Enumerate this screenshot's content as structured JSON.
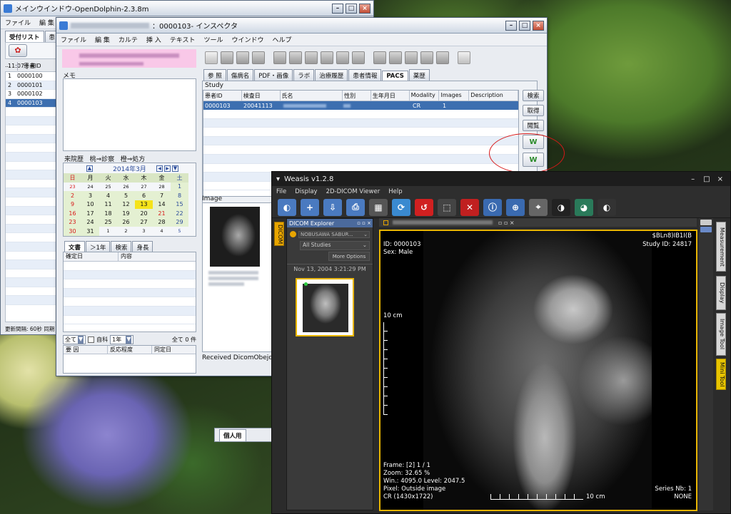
{
  "main_window": {
    "title": "メインウインドウ-OpenDolphin-2.3.8m",
    "menu": [
      "ファイル",
      "編 集",
      "カ"
    ],
    "tabs": [
      "受付リスト",
      "患"
    ],
    "time_text": "11:07 | 来",
    "col_header": "患者ID",
    "col_dots": "...",
    "rows": [
      {
        "n": "1",
        "id": "0000100"
      },
      {
        "n": "2",
        "id": "0000101"
      },
      {
        "n": "3",
        "id": "0000102"
      },
      {
        "n": "4",
        "id": "0000103"
      }
    ],
    "status": "更新間隔: 60秒 同期"
  },
  "inspector": {
    "title": "：0000103- インスペクタ",
    "menu": [
      "ファイル",
      "編 集",
      "カルテ",
      "挿 入",
      "テキスト",
      "ツール",
      "ウインドウ",
      "ヘルプ"
    ],
    "memo_label": "メモ",
    "visit_label": "来院歴",
    "legend1": "桃⇒診察",
    "legend2": "橙⇒処方",
    "cal_title": "2014年3月",
    "cal_days": [
      "日",
      "月",
      "火",
      "水",
      "木",
      "金",
      "土"
    ],
    "cal_weeks": [
      [
        "23",
        "24",
        "25",
        "26",
        "27",
        "28",
        "1"
      ],
      [
        "2",
        "3",
        "4",
        "5",
        "6",
        "7",
        "8"
      ],
      [
        "9",
        "10",
        "11",
        "12",
        "13",
        "14",
        "15"
      ],
      [
        "16",
        "17",
        "18",
        "19",
        "20",
        "21",
        "22"
      ],
      [
        "23",
        "24",
        "25",
        "26",
        "27",
        "28",
        "29"
      ],
      [
        "30",
        "31",
        "1",
        "2",
        "3",
        "4",
        "5"
      ]
    ],
    "doc_tabs": [
      "文書",
      "＞1年",
      "検索",
      "身長"
    ],
    "doc_cols": [
      "確定日",
      "内容"
    ],
    "filter_all": "全て",
    "filter_self": "自科",
    "filter_year": "1年",
    "count_text": "全て 0 件",
    "allergy_cols": [
      "要 因",
      "反応程度",
      "同定日"
    ],
    "bottom_tab": "個人用",
    "right_tabs": [
      "参 照",
      "傷病名",
      "PDF・画像",
      "ラボ",
      "治療履歴",
      "患者情報",
      "PACS",
      "薬歴"
    ],
    "study_label": "Study",
    "study_cols": [
      "患者ID",
      "検査日",
      "氏名",
      "性別",
      "生年月日",
      "Modality",
      "Images",
      "Description"
    ],
    "study_row": {
      "id": "0000103",
      "date": "20041113",
      "modality": "CR",
      "images": "1"
    },
    "buttons": [
      "検索",
      "取得",
      "閲覧"
    ],
    "image_label": "Image",
    "received_text": "Received DicomObejcet :"
  },
  "weasis": {
    "title": "Weasis v1.2.8",
    "menu": [
      "File",
      "Display",
      "2D-DICOM Viewer",
      "Help"
    ],
    "explorer_title": "DICOM Explorer",
    "side_tab": "DICOM",
    "patient_select": "NOBUSAWA SABUR...",
    "studies_select": "All Studies",
    "more_options": "More Options",
    "study_date": "Nov 13, 2004 3:21:29 PM",
    "ov": {
      "id": "ID: 0000103",
      "sex": "Sex: Male",
      "tr1": "$BLn8)IB1I(B",
      "tr2": "Study ID: 24817",
      "scale": "10 cm",
      "frame": "Frame: [2] 1 / 1",
      "zoom": "Zoom: 32.65 %",
      "win": "Win.: 4095.0 Level: 2047.5",
      "pixel": "Pixel: Outside image",
      "cr": "CR (1430x1722)",
      "hscale": "10 cm",
      "series": "Series Nb: 1",
      "none": "NONE"
    },
    "right_tabs": [
      "Measurement",
      "Display",
      "Image Tool",
      "Mini Tool"
    ]
  },
  "colors": {
    "selection": "#3d6fb0",
    "annotation": "#d81818",
    "viewer_border": "#e8b500"
  }
}
